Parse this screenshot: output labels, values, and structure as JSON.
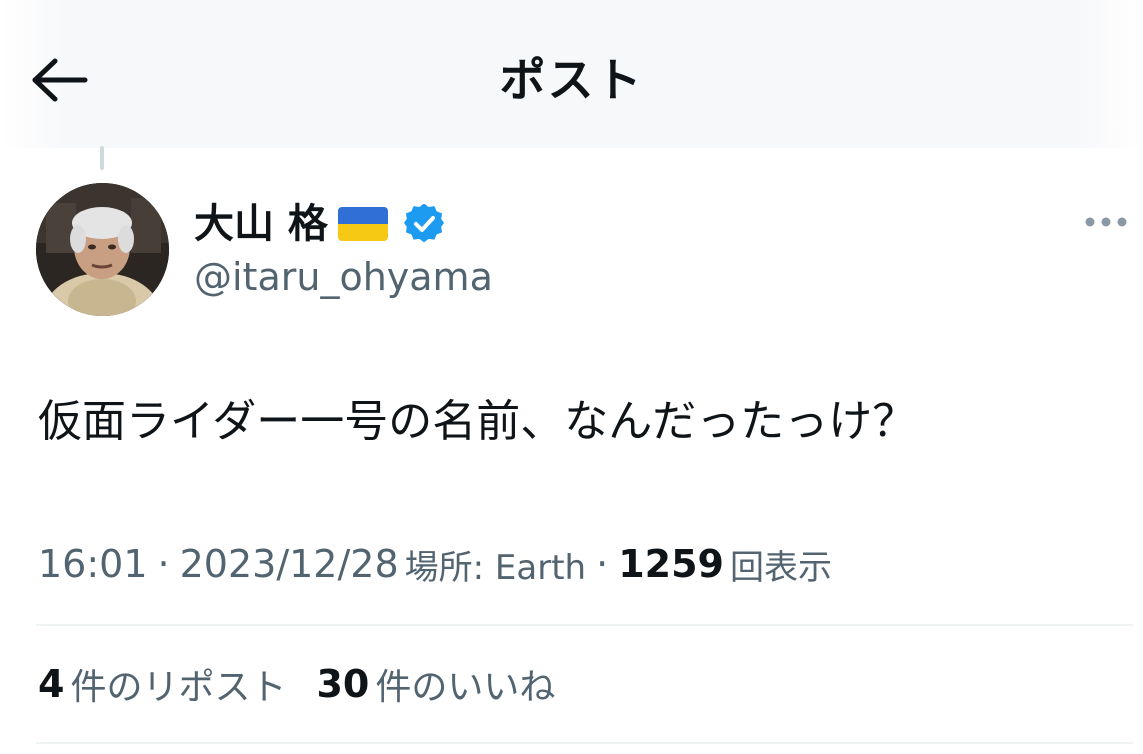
{
  "header": {
    "title": "ポスト",
    "back_icon": "arrow-left-icon"
  },
  "author": {
    "display_name": "大山 格",
    "flag_icon": "ukraine-flag-icon",
    "verified_icon": "verified-badge-icon",
    "handle": "@itaru_ohyama",
    "avatar_icon": "avatar-photo",
    "more_icon": "more-dots-icon"
  },
  "tweet": {
    "text": "仮面ライダー一号の名前、なんだったっけ？",
    "time": "16:01",
    "date": "2023/12/28",
    "separator": "·",
    "location_label": "場所: Earth",
    "views_count": "1259",
    "views_label": "回表示"
  },
  "stats": {
    "reposts_count": "4",
    "reposts_label": "件のリポスト",
    "likes_count": "30",
    "likes_label": "件のいいね"
  },
  "colors": {
    "text_primary": "#0f1419",
    "text_secondary": "#536471",
    "verified_blue": "#1d9bf0",
    "divider": "#eff3f4",
    "flag_blue": "#2f6fd6",
    "flag_yellow": "#f6c915"
  }
}
